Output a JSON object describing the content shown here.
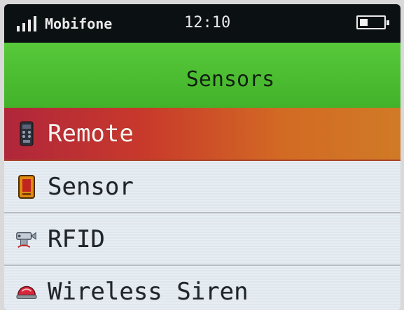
{
  "status_bar": {
    "carrier": "Mobifone",
    "time": "12:10",
    "signal_bars": 4,
    "battery_level": 0.35
  },
  "header": {
    "title": "Sensors"
  },
  "menu": {
    "items": [
      {
        "label": "Remote",
        "icon": "remote-icon",
        "selected": true
      },
      {
        "label": "Sensor",
        "icon": "sensor-icon",
        "selected": false
      },
      {
        "label": "RFID",
        "icon": "rfid-icon",
        "selected": false
      },
      {
        "label": "Wireless Siren",
        "icon": "siren-icon",
        "selected": false
      }
    ]
  },
  "colors": {
    "title_bar": "#4cbd32",
    "selected_start": "#b0263b",
    "selected_end": "#d07a26",
    "status_bar": "#0b1013"
  }
}
